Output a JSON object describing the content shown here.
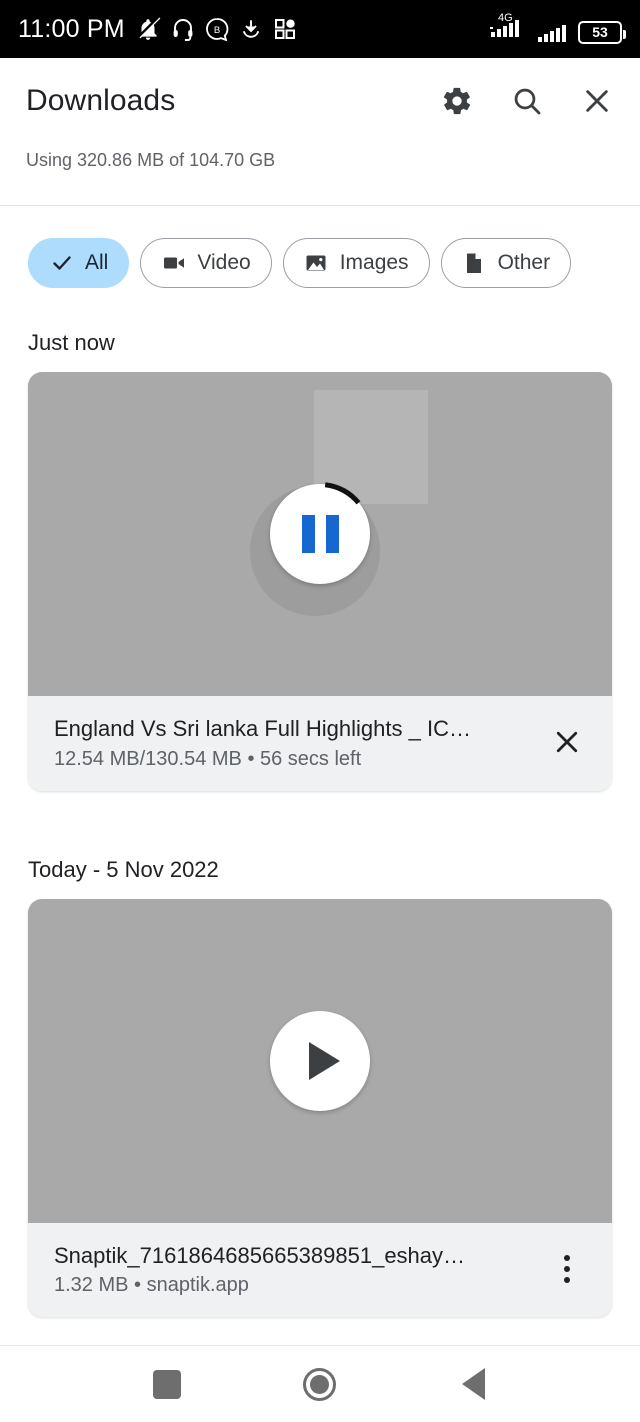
{
  "statusbar": {
    "time": "11:00 PM",
    "battery_level": "53",
    "network_type": "4G",
    "icons": [
      {
        "name": "mute-vibrate-icon"
      },
      {
        "name": "headset-icon"
      },
      {
        "name": "bluetooth-circle-icon"
      },
      {
        "name": "download-icon"
      },
      {
        "name": "app-grid-icon"
      }
    ]
  },
  "appbar": {
    "title": "Downloads",
    "storage": "Using 320.86 MB of 104.70 GB",
    "actions": [
      {
        "name": "settings-icon",
        "label": "Settings"
      },
      {
        "name": "search-icon",
        "label": "Search"
      },
      {
        "name": "close-icon",
        "label": "Close"
      }
    ]
  },
  "filters": {
    "chips": [
      {
        "label": "All",
        "icon": "check-icon",
        "selected": true
      },
      {
        "label": "Video",
        "icon": "video-camera-icon",
        "selected": false
      },
      {
        "label": "Images",
        "icon": "image-icon",
        "selected": false
      },
      {
        "label": "Other",
        "icon": "document-icon",
        "selected": false
      }
    ],
    "selected_color": "#aedcfc"
  },
  "sections": [
    {
      "header": "Just now",
      "item": {
        "title": "England Vs Sri lanka Full Highlights _ IC…",
        "subtitle": "12.54 MB/130.54 MB • 56 secs left",
        "state": "downloading",
        "fab_icon": "pause-icon",
        "action_icon": "close-icon",
        "progress_percent": 10,
        "accent_color": "#1667d1"
      }
    },
    {
      "header": "Today - 5 Nov 2022",
      "item": {
        "title": "Snaptik_7161864685665389851_eshay…",
        "subtitle": "1.32 MB • snaptik.app",
        "state": "complete",
        "fab_icon": "play-icon",
        "action_icon": "more-vertical-icon"
      }
    }
  ],
  "navbar": {
    "buttons": [
      {
        "name": "recents-button",
        "icon": "square-icon"
      },
      {
        "name": "home-button",
        "icon": "circle-icon"
      },
      {
        "name": "back-button",
        "icon": "triangle-left-icon"
      }
    ]
  }
}
